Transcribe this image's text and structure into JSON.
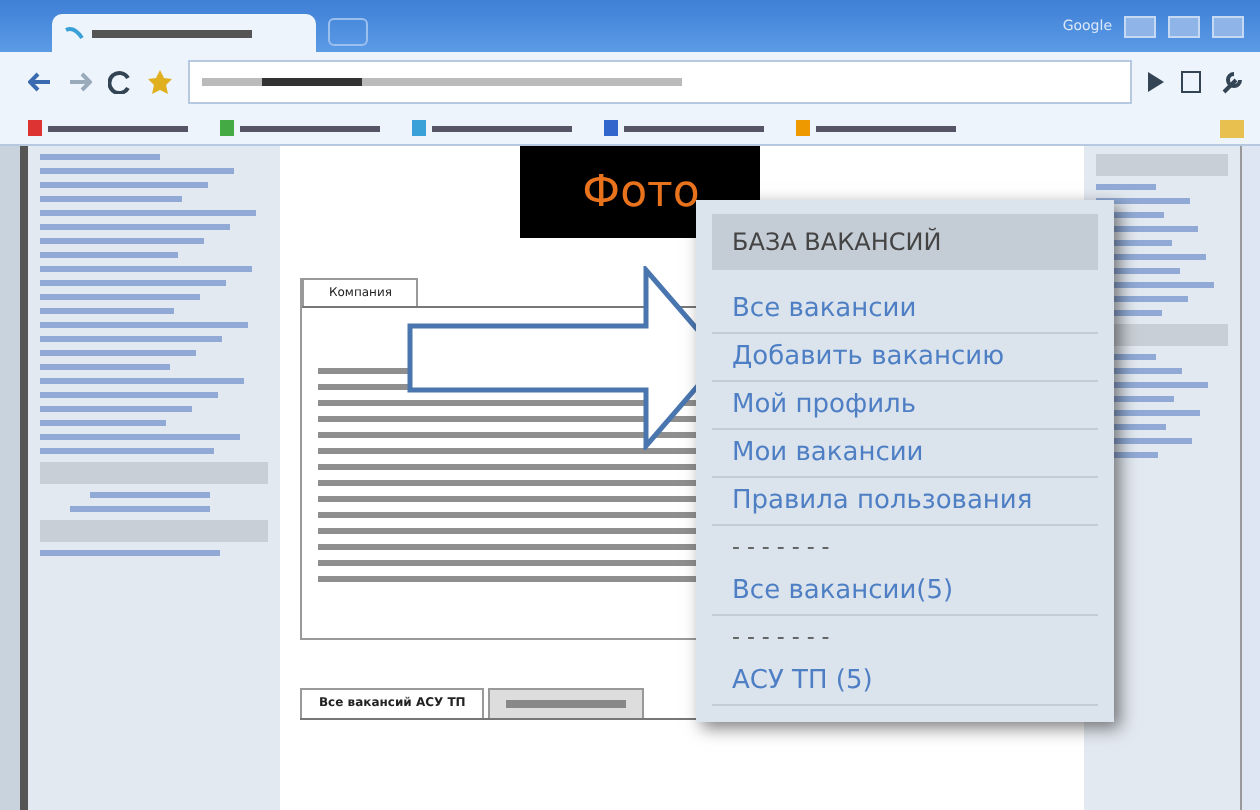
{
  "browser": {
    "window_label": "Google"
  },
  "photo": {
    "label": "Фото"
  },
  "content_tabs": [
    {
      "label": "Компания",
      "selected": true
    }
  ],
  "bottom_tabs": [
    {
      "label": "Все вакансий АСУ ТП",
      "selected": true
    },
    {
      "selected": false
    }
  ],
  "menu": {
    "title": "БАЗА ВАКАНСИЙ",
    "items": [
      {
        "kind": "link",
        "label": "Все вакансии"
      },
      {
        "kind": "link",
        "label": "Добавить вакансию"
      },
      {
        "kind": "link",
        "label": "Мой профиль"
      },
      {
        "kind": "link",
        "label": "Мои вакансии"
      },
      {
        "kind": "link",
        "label": "Правила пользования"
      },
      {
        "kind": "separator",
        "label": "- - - - - - -"
      },
      {
        "kind": "link",
        "label": "Все вакансии(5)"
      },
      {
        "kind": "separator",
        "label": "- - - - - - -"
      },
      {
        "kind": "link",
        "label": "АСУ ТП (5)"
      }
    ]
  }
}
